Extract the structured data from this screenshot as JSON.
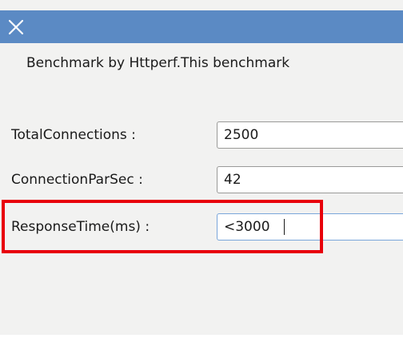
{
  "description": "Benchmark by Httperf.This benchmark",
  "fields": [
    {
      "label": "TotalConnections :",
      "value": "2500"
    },
    {
      "label": "ConnectionParSec :",
      "value": "42"
    },
    {
      "label": "ResponseTime(ms) :",
      "value": "<3000"
    }
  ],
  "colors": {
    "titlebar": "#5b8ac4",
    "dialog_bg": "#f2f2f1",
    "highlight": "#e8000b",
    "focus_border": "#7aa6da"
  },
  "icons": {
    "close": "close-icon"
  }
}
